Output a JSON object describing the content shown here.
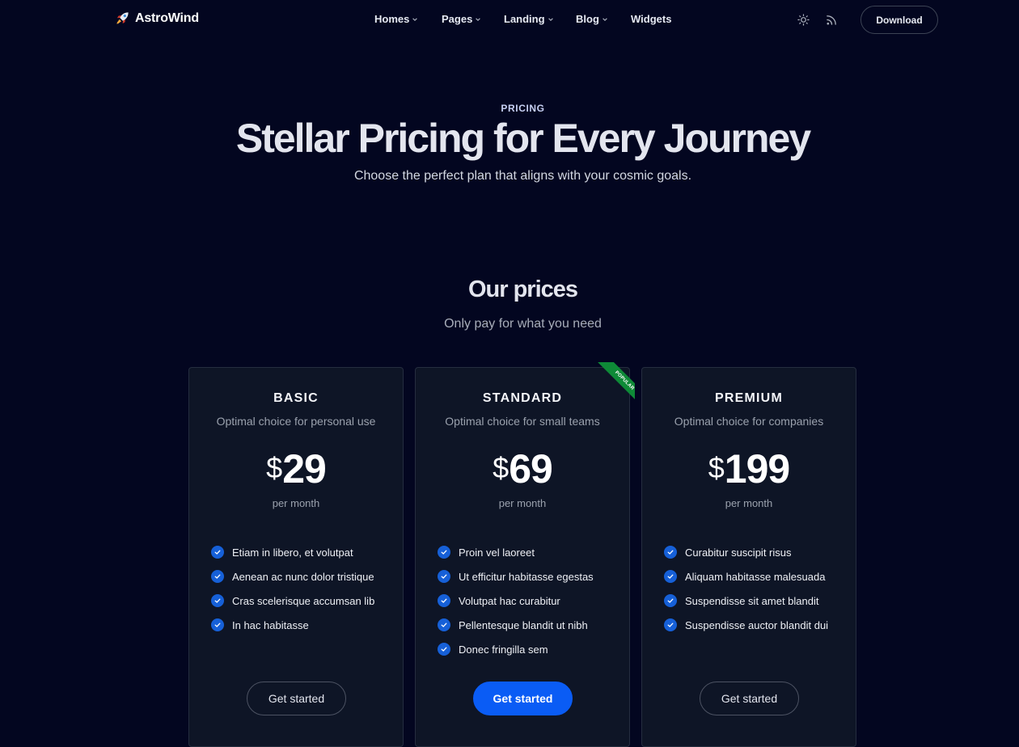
{
  "header": {
    "logo_text": "AstroWind",
    "nav": [
      {
        "label": "Homes",
        "dropdown": true
      },
      {
        "label": "Pages",
        "dropdown": true
      },
      {
        "label": "Landing",
        "dropdown": true
      },
      {
        "label": "Blog",
        "dropdown": true
      },
      {
        "label": "Widgets",
        "dropdown": false
      }
    ],
    "icons": [
      "sun-icon",
      "rss-icon"
    ],
    "download_label": "Download"
  },
  "hero": {
    "tagline": "PRICING",
    "title": "Stellar Pricing for Every Journey",
    "subtitle": "Choose the perfect plan that aligns with your cosmic goals."
  },
  "prices": {
    "title": "Our prices",
    "subtitle": "Only pay for what you need"
  },
  "plans": [
    {
      "name": "BASIC",
      "subtitle": "Optimal choice for personal use",
      "currency": "$",
      "price": "29",
      "period": "per month",
      "features": [
        "Etiam in libero, et volutpat",
        "Aenean ac nunc dolor tristique",
        "Cras scelerisque accumsan lib",
        "In hac habitasse"
      ],
      "cta": "Get started"
    },
    {
      "name": "STANDARD",
      "subtitle": "Optimal choice for small teams",
      "currency": "$",
      "price": "69",
      "period": "per month",
      "ribbon": "POPULAR",
      "features": [
        "Proin vel laoreet",
        "Ut efficitur habitasse egestas",
        "Volutpat hac curabitur",
        "Pellentesque blandit ut nibh",
        "Donec fringilla sem"
      ],
      "cta": "Get started"
    },
    {
      "name": "PREMIUM",
      "subtitle": "Optimal choice for companies",
      "currency": "$",
      "price": "199",
      "period": "per month",
      "features": [
        "Curabitur suscipit risus",
        "Aliquam habitasse malesuada",
        "Suspendisse sit amet blandit",
        "Suspendisse auctor blandit dui"
      ],
      "cta": "Get started"
    }
  ],
  "colors": {
    "background": "#030620",
    "card": "#0e1526",
    "accent": "#0a5cf5",
    "check": "#1660d8",
    "ribbon": "#0e8a37"
  }
}
